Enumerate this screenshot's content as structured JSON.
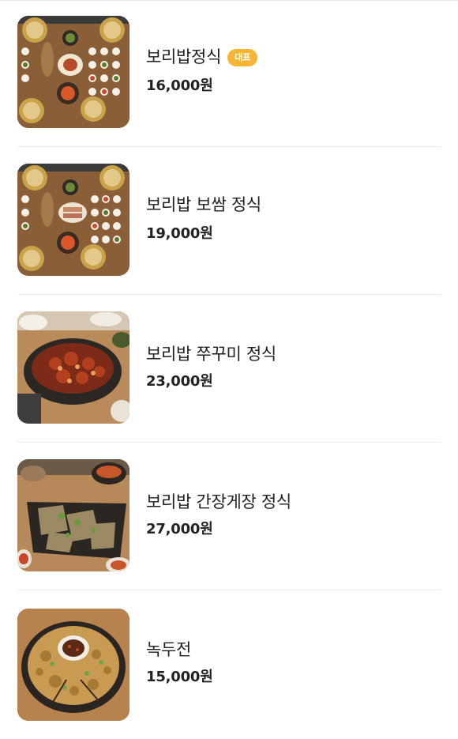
{
  "menu": {
    "items": [
      {
        "name": "보리밥정식",
        "badge": "대표",
        "price": "16,000원",
        "image": "banchan-table-set-photo"
      },
      {
        "name": "보리밥 보쌈 정식",
        "price": "19,000원",
        "image": "bossam-table-set-photo"
      },
      {
        "name": "보리밥 쭈꾸미 정식",
        "price": "23,000원",
        "image": "spicy-webfoot-octopus-photo"
      },
      {
        "name": "보리밥 간장게장 정식",
        "price": "27,000원",
        "image": "soy-marinated-crab-photo"
      },
      {
        "name": "녹두전",
        "price": "15,000원",
        "image": "mung-bean-pancake-photo"
      }
    ]
  },
  "colors": {
    "badge": "#f8b534",
    "divider": "#ededed",
    "text": "#222222"
  }
}
